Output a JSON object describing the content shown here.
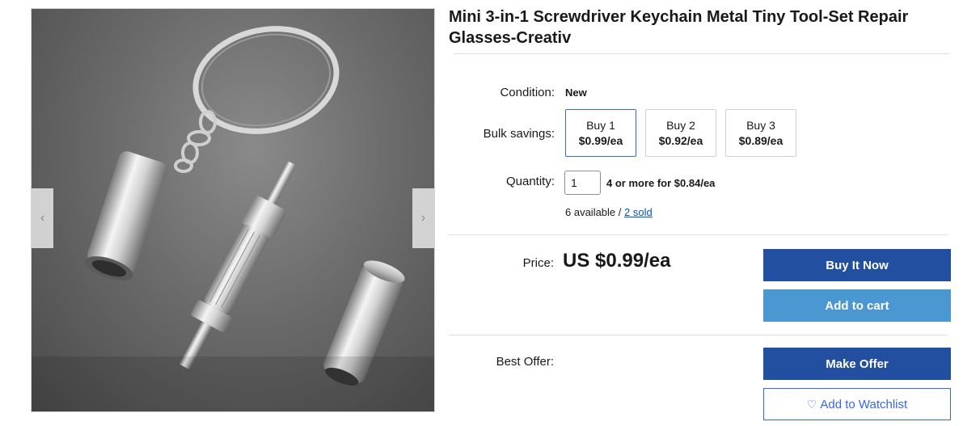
{
  "product": {
    "title": "Mini 3-in-1 Screwdriver Keychain Metal Tiny Tool-Set Repair Glasses-Creativ",
    "image_alt": "keychain screwdriver tool set photo"
  },
  "gallery": {
    "prev_icon": "‹",
    "next_icon": "›"
  },
  "condition": {
    "label": "Condition:",
    "value": "New"
  },
  "bulk": {
    "label": "Bulk savings:",
    "options": [
      {
        "qty": "Buy 1",
        "price": "$0.99/ea",
        "selected": true
      },
      {
        "qty": "Buy 2",
        "price": "$0.92/ea",
        "selected": false
      },
      {
        "qty": "Buy 3",
        "price": "$0.89/ea",
        "selected": false
      }
    ]
  },
  "quantity": {
    "label": "Quantity:",
    "value": "1",
    "deal": "4 or more for $0.84/ea",
    "available": "6 available /",
    "sold": "2 sold"
  },
  "price": {
    "label": "Price:",
    "value": "US $0.99/ea"
  },
  "buttons": {
    "buy_now": "Buy It Now",
    "add_to_cart": "Add to cart",
    "make_offer": "Make Offer",
    "watchlist": "Add to Watchlist",
    "watchlist_icon": "♡"
  },
  "best_offer": {
    "label": "Best Offer:"
  },
  "colors": {
    "primary_button": "#234fa1",
    "secondary_button": "#4b97d1",
    "link": "#0654ba",
    "selected_border": "#3665f3"
  }
}
